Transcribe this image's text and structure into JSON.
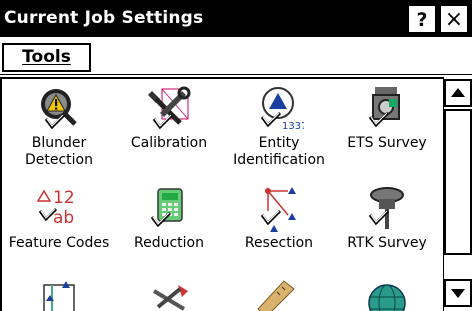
{
  "window": {
    "title": "Current Job Settings",
    "help_label": "?",
    "close_label": "×"
  },
  "menu": {
    "tools_label": "Tools"
  },
  "items": [
    {
      "label": "Blunder\nDetection",
      "icon": "blunder-detection-icon"
    },
    {
      "label": "Calibration",
      "icon": "calibration-icon"
    },
    {
      "label": "Entity\nIdentification",
      "icon": "entity-identification-icon",
      "icon_text": "1337"
    },
    {
      "label": "ETS Survey",
      "icon": "ets-survey-icon"
    },
    {
      "label": "Feature Codes",
      "icon": "feature-codes-icon",
      "icon_text_top": "12",
      "icon_text_bottom": "ab"
    },
    {
      "label": "Reduction",
      "icon": "reduction-icon"
    },
    {
      "label": "Resection",
      "icon": "resection-icon"
    },
    {
      "label": "RTK Survey",
      "icon": "rtk-survey-icon"
    },
    {
      "label": "",
      "icon": "layout-icon"
    },
    {
      "label": "",
      "icon": "tools-icon"
    },
    {
      "label": "",
      "icon": "measure-icon"
    },
    {
      "label": "",
      "icon": "globe-icon"
    }
  ]
}
